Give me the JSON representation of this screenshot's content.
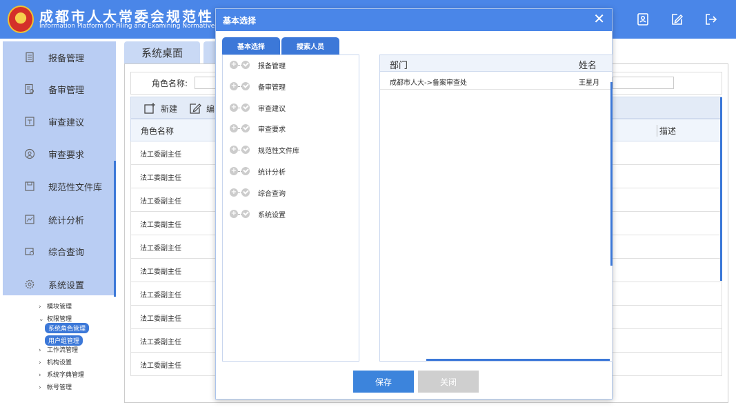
{
  "header": {
    "title": "成都市人大常委会规范性",
    "subtitle": "Information Platform for Filing and Examining Normative Documen",
    "icons": [
      "contact-card-icon",
      "edit-icon",
      "logout-icon"
    ]
  },
  "sidebar": {
    "items": [
      {
        "label": "报备管理",
        "icon": "document-icon"
      },
      {
        "label": "备审管理",
        "icon": "review-icon"
      },
      {
        "label": "审查建议",
        "icon": "suggestion-icon"
      },
      {
        "label": "审查要求",
        "icon": "user-circle-icon"
      },
      {
        "label": "规范性文件库",
        "icon": "save-icon"
      },
      {
        "label": "统计分析",
        "icon": "chart-icon"
      },
      {
        "label": "综合查询",
        "icon": "query-icon"
      },
      {
        "label": "系统设置",
        "icon": "gear-icon"
      }
    ],
    "sub_items": [
      {
        "label": "模块管理"
      },
      {
        "label": "权限管理"
      },
      {
        "label": "系统角色管理"
      },
      {
        "label": "用户组管理"
      },
      {
        "label": "工作流管理"
      },
      {
        "label": "机构设置"
      },
      {
        "label": "系统字典管理"
      },
      {
        "label": "帐号管理"
      }
    ]
  },
  "main": {
    "tab_label": "系统桌面",
    "role_label": "角色名称:",
    "toolbar": {
      "new_label": "新建",
      "edit_label": "编"
    },
    "columns": {
      "role": "角色名称",
      "desc": "描述"
    },
    "rows": [
      "法工委副主任",
      "法工委副主任",
      "法工委副主任",
      "法工委副主任",
      "法工委副主任",
      "法工委副主任",
      "法工委副主任",
      "法工委副主任",
      "法工委副主任",
      "法工委副主任"
    ]
  },
  "modal": {
    "title": "基本选择",
    "tabs": [
      "基本选择",
      "搜索人员"
    ],
    "tree": [
      "报备管理",
      "备审管理",
      "审查建议",
      "审查要求",
      "规范性文件库",
      "统计分析",
      "综合查询",
      "系统设置"
    ],
    "list": {
      "headers": {
        "dept": "部门",
        "name": "姓名"
      },
      "rows": [
        {
          "dept": "成都市人大->备案审查处",
          "name": "王星月"
        }
      ]
    },
    "save_label": "保存",
    "close_label": "关闭",
    "close_glyph": "✕"
  },
  "colors": {
    "accent": "#4a86e8",
    "sidebar_bg": "#b9cdf3",
    "primary_button": "#3c84dc",
    "disabled_button": "#cfcfcf"
  }
}
